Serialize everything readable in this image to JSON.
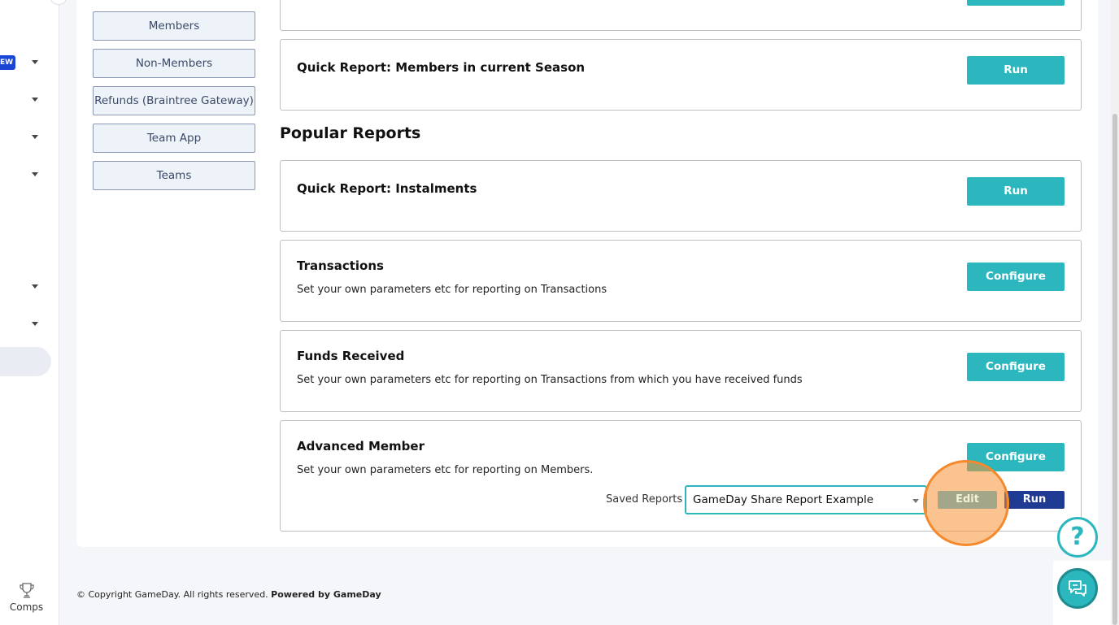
{
  "sidebar": {
    "new_badge": "EW",
    "comps_label": "Comps"
  },
  "categories": [
    "Members",
    "Non-Members",
    "Refunds (Braintree Gateway)",
    "Team App",
    "Teams"
  ],
  "top_card": {
    "button": "Run"
  },
  "quick_members": {
    "title": "Quick Report: Members in current Season",
    "button": "Run"
  },
  "popular_heading": "Popular Reports",
  "reports": {
    "instalments": {
      "title": "Quick Report: Instalments",
      "button": "Run"
    },
    "transactions": {
      "title": "Transactions",
      "description": "Set your own parameters etc for reporting on Transactions",
      "button": "Configure"
    },
    "funds": {
      "title": "Funds Received",
      "description": "Set your own parameters etc for reporting on Transactions from which you have received funds",
      "button": "Configure"
    },
    "advanced": {
      "title": "Advanced Member",
      "description": "Set your own parameters etc for reporting on Members.",
      "button": "Configure",
      "saved_label": "Saved Reports",
      "saved_value": "GameDay Share Report Example",
      "edit_label": "Edit",
      "run_label": "Run"
    }
  },
  "footer": {
    "copyright": "©  Copyright GameDay. All rights reserved.",
    "powered": "Powered by GameDay"
  },
  "help": {
    "symbol": "?"
  },
  "colors": {
    "accent": "#2bb7bd",
    "dark_button": "#1f3a93",
    "highlight": "#f58a2c"
  },
  "icons": [
    "trophy-icon",
    "help-icon",
    "chat-icon",
    "chevron-down-icon"
  ]
}
